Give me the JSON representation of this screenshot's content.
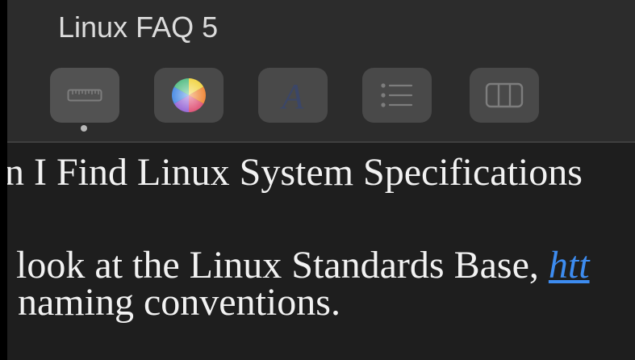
{
  "window": {
    "title": "Linux FAQ 5"
  },
  "toolbar": {
    "buttons": [
      {
        "name": "ruler-button",
        "icon": "ruler-icon",
        "active": true
      },
      {
        "name": "colors-button",
        "icon": "color-wheel-icon",
        "active": false
      },
      {
        "name": "fonts-button",
        "icon": "font-icon",
        "active": false
      },
      {
        "name": "list-button",
        "icon": "list-icon",
        "active": false
      },
      {
        "name": "table-button",
        "icon": "table-columns-icon",
        "active": false
      }
    ]
  },
  "document": {
    "heading": "n I Find Linux System Specifications",
    "body_line1_prefix": "look at the Linux Standards Base, ",
    "body_line1_link": "htt",
    "body_line2": "naming conventions."
  },
  "colors": {
    "toolbar_bg": "#2c2c2c",
    "document_bg": "#1e1e1e",
    "text": "#f2f2f2",
    "link": "#3d8cf0"
  }
}
